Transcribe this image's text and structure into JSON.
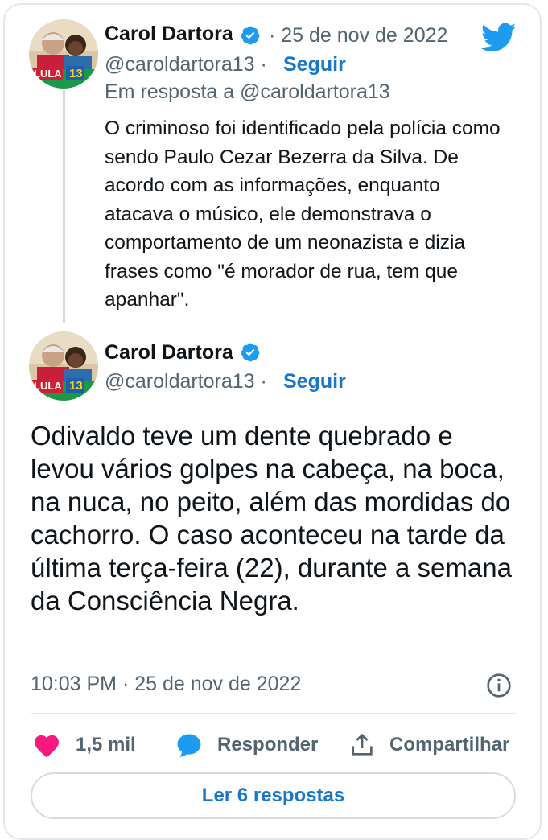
{
  "reply_tweet": {
    "author_name": "Carol Dartora",
    "date": "· 25 de nov de 2022",
    "handle": "@caroldartora13 ·",
    "follow_label": "Seguir",
    "in_reply_to": "Em resposta a @caroldartora13",
    "text": "O criminoso foi identificado pela polícia como sendo Paulo Cezar Bezerra da Silva. De acordo com as informações, enquanto atacava o músico, ele demonstrava o comportamento de um neonazista e dizia frases como \"é morador de rua, tem que apanhar\"."
  },
  "main_tweet": {
    "author_name": "Carol Dartora",
    "handle": "@caroldartora13 ·",
    "follow_label": "Seguir",
    "text": "Odivaldo teve um dente quebrado e levou vários golpes na cabeça, na boca, na nuca, no peito, além das mordidas do cachorro. O caso aconteceu na tarde da última terça-feira (22), durante a semana da Consciência Negra.",
    "timestamp": "10:03 PM · 25 de nov de 2022"
  },
  "avatar": {
    "badge_text": "LULA",
    "badge_number": "13"
  },
  "actions": {
    "likes": "1,5 mil",
    "reply_label": "Responder",
    "share_label": "Compartilhar"
  },
  "read_replies_label": "Ler 6 respostas",
  "colors": {
    "brand_blue": "#1d9bf0",
    "link_blue": "#1877c7",
    "like_pink": "#f91880",
    "text_gray": "#536471"
  },
  "icons": [
    "twitter-logo-icon",
    "verified-badge-icon",
    "heart-icon",
    "reply-bubble-icon",
    "share-icon",
    "info-icon"
  ]
}
